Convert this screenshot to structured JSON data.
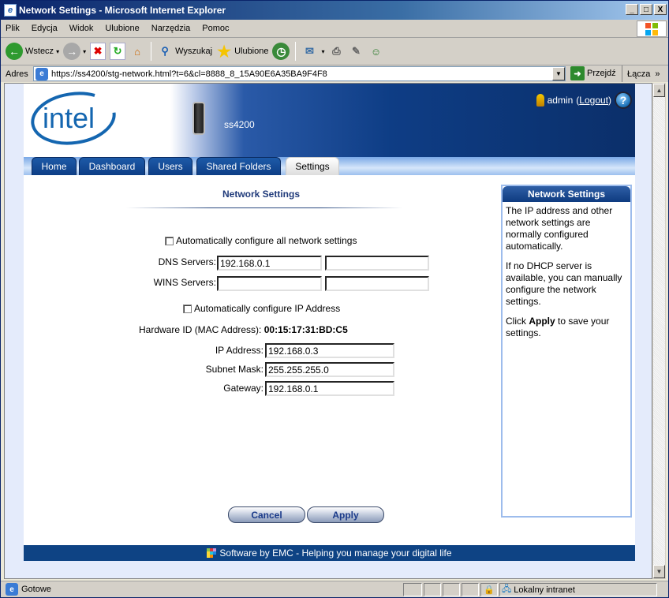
{
  "window": {
    "title": "Network Settings - Microsoft Internet Explorer",
    "controls": {
      "minimize": "_",
      "maximize": "□",
      "close": "X"
    }
  },
  "menubar": {
    "items": [
      "Plik",
      "Edycja",
      "Widok",
      "Ulubione",
      "Narzędzia",
      "Pomoc"
    ]
  },
  "toolbar": {
    "back_label": "Wstecz",
    "search_label": "Wyszukaj",
    "favorites_label": "Ulubione"
  },
  "addressbar": {
    "label": "Adres",
    "url": "https://ss4200/stg-network.html?t=6&cl=8888_8_15A90E6A35BA9F4F8",
    "go_label": "Przejdź",
    "links_label": "Łącza"
  },
  "header": {
    "logo": "intel",
    "device_name": "ss4200",
    "user": "admin",
    "logout_label": "Logout",
    "help_icon": "?"
  },
  "nav": {
    "tabs": [
      {
        "label": "Home",
        "active": false
      },
      {
        "label": "Dashboard",
        "active": false
      },
      {
        "label": "Users",
        "active": false
      },
      {
        "label": "Shared Folders",
        "active": false
      },
      {
        "label": "Settings",
        "active": true
      }
    ]
  },
  "form": {
    "title": "Network Settings",
    "auto_all_label": "Automatically configure all network settings",
    "auto_all_checked": false,
    "dns_label": "DNS Servers:",
    "dns1": "192.168.0.1",
    "dns2": "",
    "wins_label": "WINS Servers:",
    "wins1": "",
    "wins2": "",
    "auto_ip_label": "Automatically configure IP Address",
    "auto_ip_checked": false,
    "mac_label": "Hardware ID (MAC Address):",
    "mac_value": "00:15:17:31:BD:C5",
    "ip_label": "IP Address:",
    "ip_value": "192.168.0.3",
    "subnet_label": "Subnet Mask:",
    "subnet_value": "255.255.255.0",
    "gateway_label": "Gateway:",
    "gateway_value": "192.168.0.1",
    "cancel_label": "Cancel",
    "apply_label": "Apply"
  },
  "sidebar": {
    "title": "Network Settings",
    "p1": "The IP address and other network settings are normally configured automatically.",
    "p2": "If no DHCP server is available, you can manually configure the network settings.",
    "p3_pre": "Click ",
    "p3_bold": "Apply",
    "p3_post": " to save your settings."
  },
  "footer": {
    "text": "Software by EMC - Helping you manage your digital life"
  },
  "statusbar": {
    "status": "Gotowe",
    "zone": "Lokalny intranet"
  }
}
